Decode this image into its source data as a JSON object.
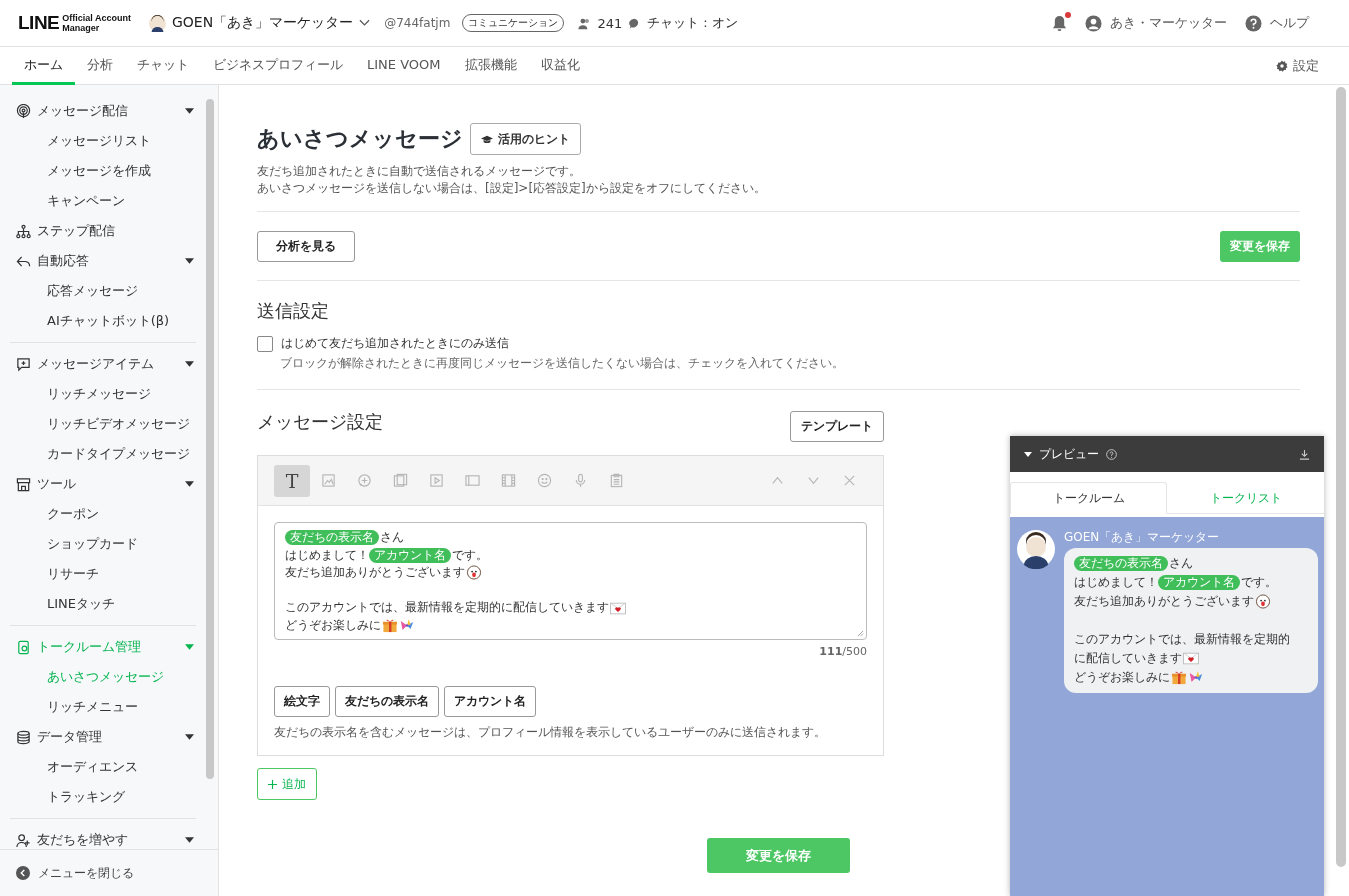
{
  "header": {
    "logo": {
      "wordmark": "LINE",
      "product_lines": [
        "Official Account",
        "Manager"
      ]
    },
    "account": {
      "name": "GOEN「あき」マーケッター",
      "handle": "@744fatjm",
      "plan": "コミュニケーション",
      "friends": "241",
      "chat_status": "チャット : オン"
    },
    "notifications": {
      "unread": true
    },
    "user": "あき・マーケッター",
    "help": "ヘルプ"
  },
  "nav": {
    "tabs": [
      {
        "label": "ホーム",
        "selected": true
      },
      {
        "label": "分析",
        "selected": false
      },
      {
        "label": "チャット",
        "selected": false
      },
      {
        "label": "ビジネスプロフィール",
        "selected": false
      },
      {
        "label": "LINE VOOM",
        "selected": false
      },
      {
        "label": "拡張機能",
        "selected": false
      },
      {
        "label": "収益化",
        "selected": false
      }
    ],
    "settings": "設定"
  },
  "sidebar": {
    "groups": [
      {
        "sections": [
          {
            "label": "メッセージ配信",
            "kind": "group",
            "expanded": true,
            "selected": false,
            "children": [
              {
                "label": "メッセージリスト",
                "selected": false
              },
              {
                "label": "メッセージを作成",
                "selected": false
              },
              {
                "label": "キャンペーン",
                "selected": false
              }
            ]
          },
          {
            "label": "ステップ配信",
            "kind": "link",
            "selected": false
          },
          {
            "label": "自動応答",
            "kind": "group",
            "expanded": true,
            "selected": false,
            "children": [
              {
                "label": "応答メッセージ",
                "selected": false
              },
              {
                "label": "AIチャットボット(β)",
                "selected": false
              }
            ]
          }
        ]
      },
      {
        "sections": [
          {
            "label": "メッセージアイテム",
            "kind": "group",
            "expanded": true,
            "selected": false,
            "children": [
              {
                "label": "リッチメッセージ",
                "selected": false
              },
              {
                "label": "リッチビデオメッセージ",
                "selected": false
              },
              {
                "label": "カードタイプメッセージ",
                "selected": false
              }
            ]
          },
          {
            "label": "ツール",
            "kind": "group",
            "expanded": true,
            "selected": false,
            "children": [
              {
                "label": "クーポン",
                "selected": false
              },
              {
                "label": "ショップカード",
                "selected": false
              },
              {
                "label": "リサーチ",
                "selected": false
              },
              {
                "label": "LINEタッチ",
                "selected": false
              }
            ]
          }
        ]
      },
      {
        "sections": [
          {
            "label": "トークルーム管理",
            "kind": "group",
            "expanded": true,
            "selected": true,
            "children": [
              {
                "label": "あいさつメッセージ",
                "selected": true
              },
              {
                "label": "リッチメニュー",
                "selected": false
              }
            ]
          },
          {
            "label": "データ管理",
            "kind": "group",
            "expanded": true,
            "selected": false,
            "children": [
              {
                "label": "オーディエンス",
                "selected": false
              },
              {
                "label": "トラッキング",
                "selected": false
              }
            ]
          }
        ]
      },
      {
        "sections": [
          {
            "label": "友だちを増やす",
            "kind": "group",
            "expanded": true,
            "selected": false
          }
        ]
      }
    ],
    "close_label": "メニューを閉じる"
  },
  "page": {
    "title": "あいさつメッセージ",
    "hint_button": "活用のヒント",
    "description": [
      "友だち追加されたときに自動で送信されるメッセージです。",
      "あいさつメッセージを送信しない場合は、[設定]>[応答設定]から設定をオフにしてください。"
    ],
    "analytics_button": "分析を見る",
    "save_button": "変更を保存"
  },
  "send_settings": {
    "heading": "送信設定",
    "checkbox": {
      "label": "はじめて友だち追加されたときにのみ送信",
      "checked": false,
      "note": "ブロックが解除されたときに再度同じメッセージを送信したくない場合は、チェックを入れてください。"
    }
  },
  "message_settings": {
    "heading": "メッセージ設定",
    "template_button": "テンプレート",
    "tools": [
      {
        "kind": "text",
        "label": "T",
        "selected": true
      },
      {
        "kind": "image",
        "selected": false
      },
      {
        "kind": "chat",
        "selected": false
      },
      {
        "kind": "gallery",
        "selected": false
      },
      {
        "kind": "video",
        "selected": false
      },
      {
        "kind": "card",
        "selected": false
      },
      {
        "kind": "film",
        "selected": false
      },
      {
        "kind": "sticker",
        "selected": false
      },
      {
        "kind": "voice",
        "selected": false
      },
      {
        "kind": "clipboard",
        "selected": false
      }
    ],
    "order_tools": [
      {
        "kind": "up"
      },
      {
        "kind": "down"
      },
      {
        "kind": "close"
      }
    ],
    "message": [
      {
        "kind": "text",
        "segments": [
          {
            "kind": "tag",
            "text": "友だちの表示名"
          },
          {
            "kind": "text",
            "text": "さん"
          }
        ]
      },
      {
        "kind": "text",
        "segments": [
          {
            "kind": "text",
            "text": "はじめまして！"
          },
          {
            "kind": "tag",
            "text": "アカウント名"
          },
          {
            "kind": "text",
            "text": "です。"
          }
        ]
      },
      {
        "kind": "text",
        "segments": [
          {
            "kind": "text",
            "text": "友だち追加ありがとうございます"
          },
          {
            "kind": "face-emoji"
          }
        ]
      },
      {
        "kind": "blank"
      },
      {
        "kind": "text",
        "segments": [
          {
            "kind": "text",
            "text": "このアカウントでは、最新情報を定期的に配信していきます"
          },
          {
            "kind": "letter-emoji"
          }
        ]
      },
      {
        "kind": "text",
        "segments": [
          {
            "kind": "text",
            "text": "どうぞお楽しみに"
          },
          {
            "kind": "gift-emoji"
          },
          {
            "kind": "bird-emoji"
          }
        ]
      }
    ],
    "counter": "**111**/500",
    "insert_buttons": [
      "絵文字",
      "友だちの表示名",
      "アカウント名"
    ],
    "note": "友だちの表示名を含むメッセージは、プロフィール情報を表示しているユーザーのみに送信されます。"
  },
  "add_button": "追加",
  "bottom_save_button": "変更を保存",
  "preview": {
    "title": "プレビュー",
    "tabs": [
      {
        "label": "トークルーム",
        "selected": true
      },
      {
        "label": "トークリスト",
        "selected": false
      }
    ],
    "sender": "GOEN「あき」マーケッター",
    "message": [
      {
        "kind": "text",
        "segments": [
          {
            "kind": "tag",
            "text": "友だちの表示名"
          },
          {
            "kind": "text",
            "text": "さん"
          }
        ]
      },
      {
        "kind": "text",
        "segments": [
          {
            "kind": "text",
            "text": "はじめまして！"
          },
          {
            "kind": "tag",
            "text": "アカウント名"
          },
          {
            "kind": "text",
            "text": "です。"
          }
        ]
      },
      {
        "kind": "text",
        "segments": [
          {
            "kind": "text",
            "text": "友だち追加ありがとうございます"
          },
          {
            "kind": "face-emoji"
          }
        ]
      },
      {
        "kind": "blank"
      },
      {
        "kind": "text",
        "segments": [
          {
            "kind": "text",
            "text": "このアカウントでは、最新情報を定期的"
          }
        ]
      },
      {
        "kind": "text",
        "segments": [
          {
            "kind": "text",
            "text": "に配信していきます"
          },
          {
            "kind": "letter-emoji"
          }
        ]
      },
      {
        "kind": "text",
        "segments": [
          {
            "kind": "text",
            "text": "どうぞお楽しみに"
          },
          {
            "kind": "gift-emoji"
          },
          {
            "kind": "bird-emoji"
          }
        ]
      }
    ]
  }
}
